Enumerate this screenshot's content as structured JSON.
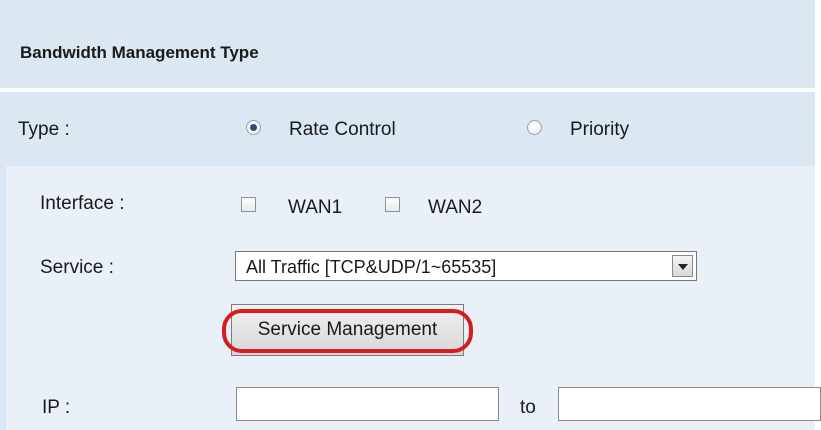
{
  "section": {
    "title": "Bandwidth Management Type"
  },
  "type": {
    "label": "Type :",
    "options": [
      {
        "label": "Rate Control",
        "checked": true
      },
      {
        "label": "Priority",
        "checked": false
      }
    ]
  },
  "interface": {
    "label": "Interface :",
    "options": [
      {
        "label": "WAN1",
        "checked": false
      },
      {
        "label": "WAN2",
        "checked": false
      }
    ]
  },
  "service": {
    "label": "Service :",
    "selected": "All Traffic [TCP&UDP/1~65535]",
    "management_button": "Service Management"
  },
  "ip": {
    "label": "IP :",
    "from_value": "",
    "to_label": "to",
    "to_value": ""
  },
  "colors": {
    "header_bg": "#dbe7f3",
    "panel_bg": "#e9f0f7",
    "highlight": "#d61c1c"
  }
}
